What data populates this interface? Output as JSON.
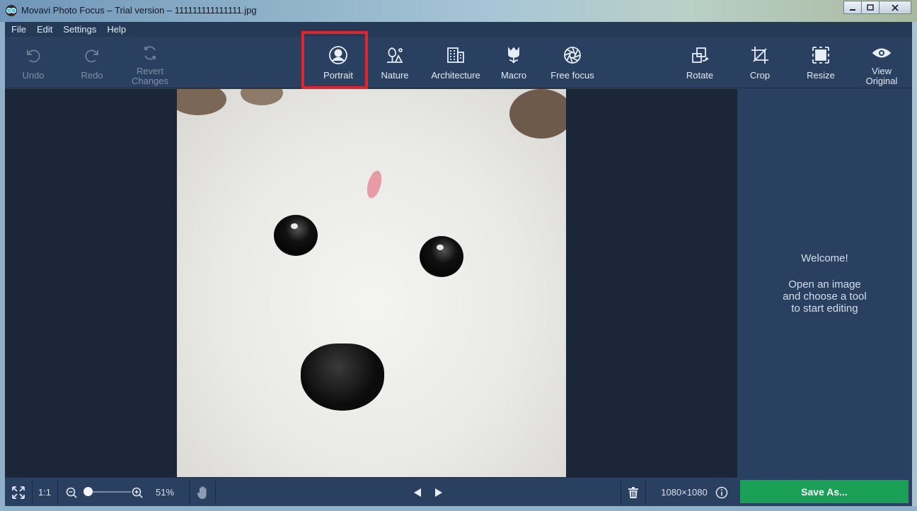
{
  "window": {
    "title": "Movavi Photo Focus – Trial version – 111111111111111.jpg",
    "controls": [
      "minimize",
      "maximize",
      "close"
    ]
  },
  "menu": [
    "File",
    "Edit",
    "Settings",
    "Help"
  ],
  "toolbar": {
    "undo": {
      "label": "Undo",
      "icon": "undo-icon",
      "enabled": false
    },
    "redo": {
      "label": "Redo",
      "icon": "redo-icon",
      "enabled": false
    },
    "revert": {
      "label": "Revert\nChanges",
      "icon": "refresh-icon",
      "enabled": false
    },
    "portrait": {
      "label": "Portrait",
      "icon": "person-icon",
      "highlighted": true
    },
    "nature": {
      "label": "Nature",
      "icon": "tree-icon"
    },
    "architecture": {
      "label": "Architecture",
      "icon": "building-icon"
    },
    "macro": {
      "label": "Macro",
      "icon": "tulip-icon"
    },
    "free_focus": {
      "label": "Free focus",
      "icon": "aperture-icon"
    },
    "rotate": {
      "label": "Rotate",
      "icon": "rotate-icon"
    },
    "crop": {
      "label": "Crop",
      "icon": "crop-icon"
    },
    "resize": {
      "label": "Resize",
      "icon": "resize-icon"
    },
    "view_original": {
      "label": "View\nOriginal",
      "icon": "eye-icon"
    }
  },
  "right_panel": {
    "welcome_title": "Welcome!",
    "welcome_body": "Open an image\nand choose a tool\nto start editing"
  },
  "bottom_bar": {
    "fit_icon": "fit-screen-icon",
    "actual_size": "1:1",
    "zoom_percent": "51%",
    "zoom_level": 0.1,
    "image_dimensions": "1080×1080",
    "save_button": "Save As..."
  },
  "colors": {
    "toolbar_bg": "#2a4060",
    "canvas_bg": "#1b2738",
    "highlight": "#e8222a",
    "save_green": "#19a056"
  }
}
